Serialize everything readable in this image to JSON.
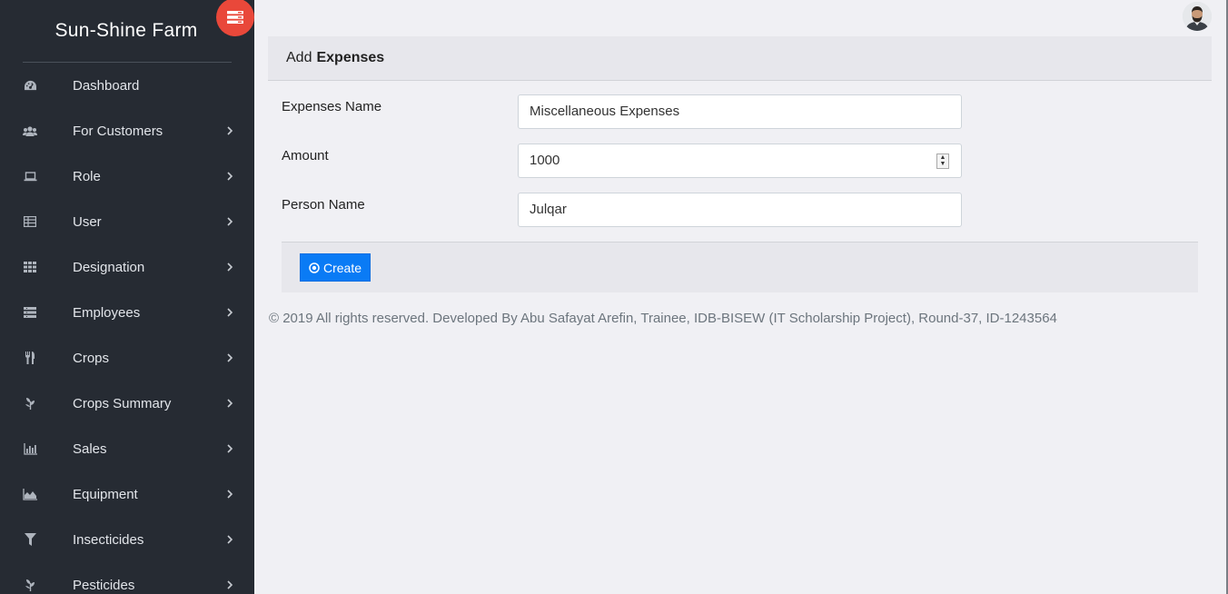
{
  "brand": "Sun-Shine Farm",
  "nav": [
    {
      "label": "Dashboard",
      "icon": "dashboard-icon",
      "has_children": false
    },
    {
      "label": "For Customers",
      "icon": "users-icon",
      "has_children": true
    },
    {
      "label": "Role",
      "icon": "laptop-icon",
      "has_children": true
    },
    {
      "label": "User",
      "icon": "table-icon",
      "has_children": true
    },
    {
      "label": "Designation",
      "icon": "grid-icon",
      "has_children": true
    },
    {
      "label": "Employees",
      "icon": "list-icon",
      "has_children": true
    },
    {
      "label": "Crops",
      "icon": "utensils-icon",
      "has_children": true
    },
    {
      "label": "Crops Summary",
      "icon": "leaf-icon",
      "has_children": true
    },
    {
      "label": "Sales",
      "icon": "bar-chart-icon",
      "has_children": true
    },
    {
      "label": "Equipment",
      "icon": "area-chart-icon",
      "has_children": true
    },
    {
      "label": "Insecticides",
      "icon": "filter-icon",
      "has_children": true
    },
    {
      "label": "Pesticides",
      "icon": "leaf-icon",
      "has_children": true
    }
  ],
  "card": {
    "title_prefix": "Add",
    "title_bold": "Expenses"
  },
  "form": {
    "expenses_name_label": "Expenses Name",
    "expenses_name_value": "Miscellaneous Expenses",
    "amount_label": "Amount",
    "amount_value": "1000",
    "person_name_label": "Person Name",
    "person_name_value": "Julqar"
  },
  "create_button": "Create",
  "copyright": "© 2019 All rights reserved. Developed By Abu Safayat Arefin, Trainee, IDB-BISEW (IT Scholarship Project), Round-37, ID-1243564",
  "colors": {
    "sidebar": "#262b33",
    "toggle": "#e9483a",
    "primary": "#0a7bf5"
  }
}
